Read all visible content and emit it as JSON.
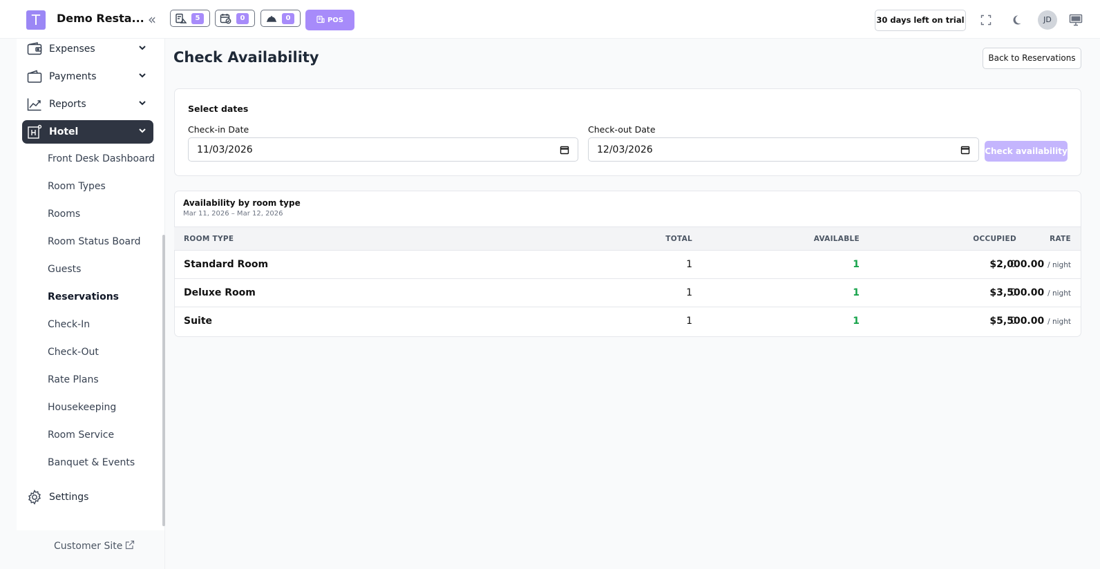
{
  "app": {
    "logo_letter": "T",
    "title": "Demo Resta..."
  },
  "topbar": {
    "chips": [
      {
        "icon": "kitchen-orders-icon",
        "count": "5"
      },
      {
        "icon": "calendar-check-icon",
        "count": "0"
      },
      {
        "icon": "cloche-icon",
        "count": "0"
      }
    ],
    "pos_label": "POS",
    "trial_text": "30 days left on trial",
    "avatar_initials": "JD"
  },
  "sidebar": {
    "items": [
      {
        "label": "Expenses",
        "icon": "wallet-icon"
      },
      {
        "label": "Payments",
        "icon": "payments-icon"
      },
      {
        "label": "Reports",
        "icon": "chart-line-icon"
      },
      {
        "label": "Hotel",
        "icon": "hotel-icon"
      }
    ],
    "hotel_sub": [
      "Front Desk Dashboard",
      "Room Types",
      "Rooms",
      "Room Status Board",
      "Guests",
      "Reservations",
      "Check-In",
      "Check-Out",
      "Rate Plans",
      "Housekeeping",
      "Room Service",
      "Banquet & Events"
    ],
    "settings_label": "Settings",
    "customer_site": "Customer Site"
  },
  "page": {
    "title": "Check Availability",
    "back_label": "Back to Reservations"
  },
  "dates": {
    "section_title": "Select dates",
    "checkin_label": "Check-in Date",
    "checkin_value": "11/03/2026",
    "checkout_label": "Check-out Date",
    "checkout_value": "12/03/2026",
    "button_label": "Check availability"
  },
  "availability": {
    "title": "Availability by room type",
    "range": "Mar 11, 2026 – Mar 12, 2026",
    "columns": [
      "ROOM TYPE",
      "TOTAL",
      "AVAILABLE",
      "OCCUPIED",
      "RATE"
    ],
    "per_night": "/ night",
    "rows": [
      {
        "room_type": "Standard Room",
        "total": "1",
        "available": "1",
        "occupied": "0",
        "rate": "$2,000.00"
      },
      {
        "room_type": "Deluxe Room",
        "total": "1",
        "available": "1",
        "occupied": "0",
        "rate": "$3,500.00"
      },
      {
        "room_type": "Suite",
        "total": "1",
        "available": "1",
        "occupied": "0",
        "rate": "$5,500.00"
      }
    ]
  },
  "colors": {
    "accent": "#a78bfa",
    "active_nav": "#2f3542",
    "available_green": "#16a34a"
  }
}
